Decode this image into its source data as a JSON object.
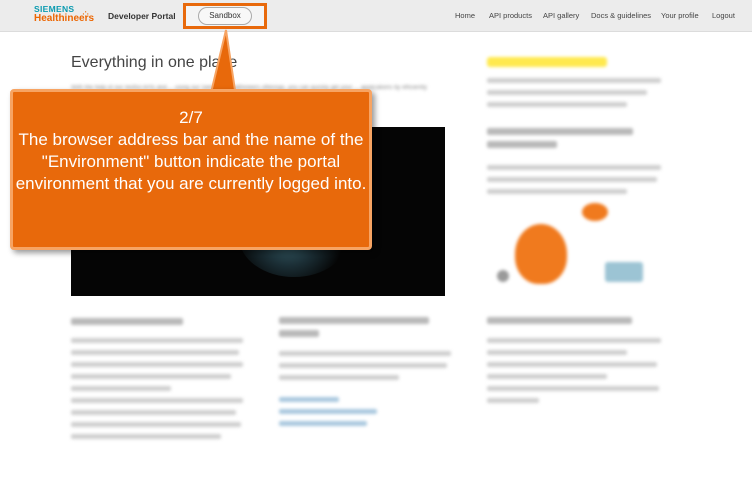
{
  "header": {
    "brand_top": "SIEMENS",
    "brand_bottom": "Healthineers",
    "portal_name": "Developer Portal",
    "environment_button": "Sandbox",
    "nav": [
      "Home",
      "API products",
      "API gallery",
      "Docs & guidelines",
      "Your profile",
      "Logout"
    ]
  },
  "main": {
    "heading": "Everything in one place",
    "intro": "With the help of our restful APIs and ... using our Siemens Healthineers offerings, you can quickly get your ... applications by efficiently"
  },
  "callout": {
    "step": "2/7",
    "text": "The browser address bar and the name of the \"Environment\" button indicate the portal environment that you are currently logged into."
  },
  "colors": {
    "accent": "#e8690b",
    "brand_teal": "#0b9bb0"
  }
}
